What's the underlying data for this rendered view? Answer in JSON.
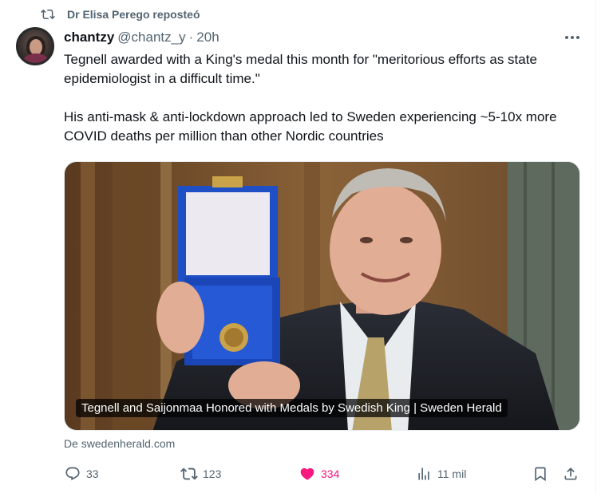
{
  "repost": {
    "text": "Dr Elisa Perego reposteó"
  },
  "post": {
    "author_name": "chantzy",
    "author_handle": "@chantz_y",
    "separator": "·",
    "time": "20h",
    "text_p1": "Tegnell awarded with a King's medal this month for \"meritorious efforts as state epidemiologist in a difficult time.\"",
    "text_p2": "His anti-mask & anti-lockdown approach led to Sweden experiencing ~5-10x more COVID deaths per million than other Nordic countries"
  },
  "card": {
    "caption": "Tegnell and Saijonmaa Honored with Medals by Swedish King | Sweden Herald",
    "source": "De swedenherald.com"
  },
  "actions": {
    "replies": "33",
    "reposts": "123",
    "likes": "334",
    "views": "11 mil"
  },
  "icons": {
    "repost": "repost-icon",
    "more": "more-icon",
    "reply": "reply-icon",
    "like": "heart-icon",
    "views": "views-icon",
    "bookmark": "bookmark-icon",
    "share": "share-icon"
  },
  "colors": {
    "like": "#f91880",
    "muted": "#536471",
    "text": "#0f1419"
  }
}
